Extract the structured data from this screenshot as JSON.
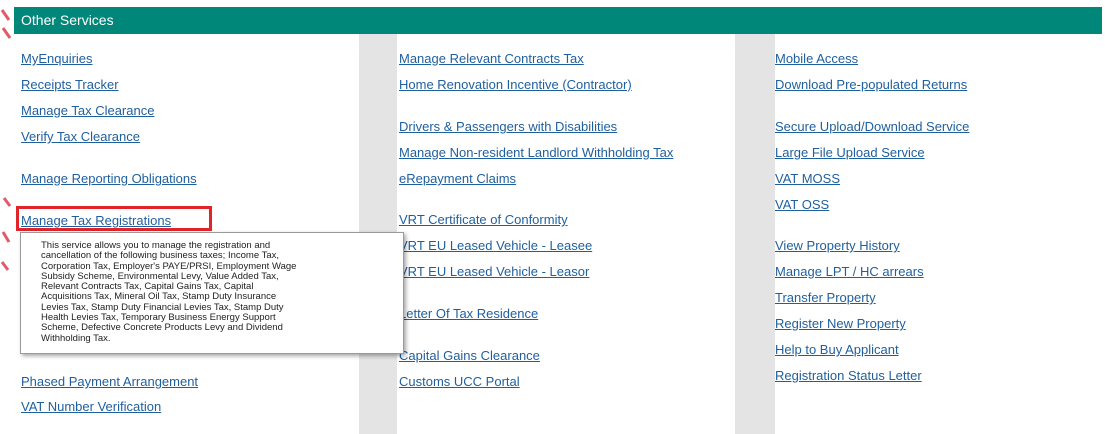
{
  "header": {
    "title": "Other Services"
  },
  "columns": [
    {
      "links": [
        "MyEnquiries",
        "Receipts Tracker",
        "Manage Tax Clearance",
        "Verify Tax Clearance",
        "Manage Reporting Obligations",
        "Manage Tax Registrations",
        "Phased Payment Arrangement",
        "VAT Number Verification"
      ]
    },
    {
      "links": [
        "Manage Relevant Contracts Tax",
        "Home Renovation Incentive (Contractor)",
        "Drivers & Passengers with Disabilities",
        "Manage Non-resident Landlord Withholding Tax",
        "eRepayment Claims",
        "VRT Certificate of Conformity",
        "VRT EU Leased Vehicle - Leasee",
        "VRT EU Leased Vehicle - Leasor",
        "Letter Of Tax Residence",
        "Capital Gains Clearance",
        "Customs UCC Portal"
      ]
    },
    {
      "links": [
        "Mobile Access",
        "Download Pre-populated Returns",
        "Secure Upload/Download Service",
        "Large File Upload Service",
        "VAT MOSS",
        "VAT OSS",
        "View Property History",
        "Manage LPT / HC arrears",
        "Transfer Property",
        "Register New Property",
        "Help to Buy Applicant",
        "Registration Status Letter"
      ]
    }
  ],
  "tooltip": {
    "lines": [
      "This service allows you to manage the registration and",
      "cancellation of the following business taxes; Income Tax,",
      "Corporation Tax, Employer's PAYE/PRSI, Employment Wage",
      "Subsidy Scheme, Environmental Levy, Value Added Tax,",
      "Relevant Contracts Tax, Capital Gains Tax, Capital",
      "Acquisitions Tax, Mineral Oil Tax, Stamp Duty Insurance",
      "Levies Tax, Stamp Duty Financial Levies Tax, Stamp Duty",
      "Health Levies Tax, Temporary Business Energy Support",
      "Scheme, Defective Concrete Products Levy and Dividend",
      "Withholding Tax."
    ]
  },
  "colors": {
    "header_bg": "#00877a",
    "link": "#1f5f9e",
    "highlight": "#e0242a"
  }
}
